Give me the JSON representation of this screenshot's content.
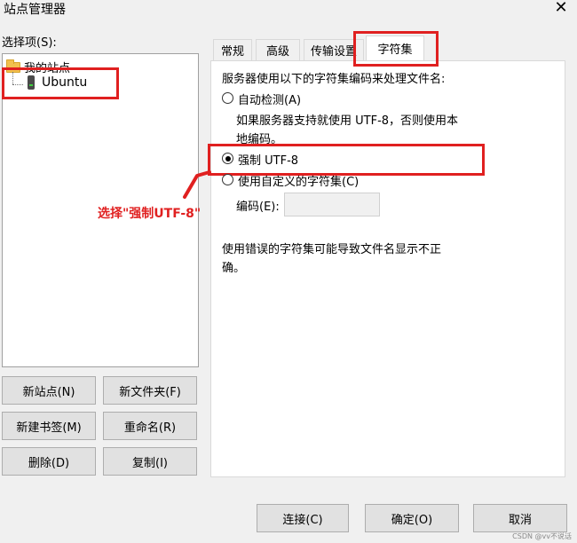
{
  "window": {
    "title": "站点管理器",
    "close_glyph": "✕"
  },
  "left": {
    "select_label": "选择项(S):",
    "tree": [
      {
        "label": "我的站点"
      },
      {
        "label": "Ubuntu"
      }
    ]
  },
  "left_buttons": {
    "new_site": "新站点(N)",
    "new_folder": "新文件夹(F)",
    "new_bookmark": "新建书签(M)",
    "rename": "重命名(R)",
    "delete": "删除(D)",
    "copy": "复制(I)"
  },
  "tabs": [
    "常规",
    "高级",
    "传输设置",
    "字符集"
  ],
  "charset": {
    "intro": "服务器使用以下的字符集编码来处理文件名:",
    "auto_detect": "自动检测(A)",
    "auto_desc_line1": "如果服务器支持就使用 UTF-8，否则使用本",
    "auto_desc_line2": "地编码。",
    "force_utf8": "强制 UTF-8",
    "custom": "使用自定义的字符集(C)",
    "encoding_label": "编码(E):",
    "encoding_value": "",
    "warning_line1": "使用错误的字符集可能导致文件名显示不正",
    "warning_line2": "确。"
  },
  "annotation": {
    "text": "选择\"强制UTF-8\"",
    "color": "#e02020"
  },
  "footer": {
    "connect": "连接(C)",
    "ok": "确定(O)",
    "cancel": "取消"
  },
  "watermark": "CSDN @vv不说话"
}
